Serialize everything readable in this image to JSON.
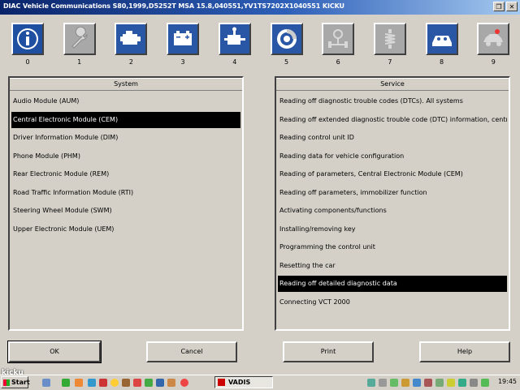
{
  "window": {
    "title": "DIAC  Vehicle Communications  S80,1999,D5252T MSA 15.8,040551,YV1TS7202X1040551 KICKU",
    "restore_label": "❐",
    "close_label": "✕"
  },
  "toolbar": {
    "items": [
      {
        "number": "0",
        "icon": "information-icon",
        "state": "active"
      },
      {
        "number": "1",
        "icon": "wrench-icon",
        "state": "disabled"
      },
      {
        "number": "2",
        "icon": "engine-icon",
        "state": "on"
      },
      {
        "number": "3",
        "icon": "battery-icon",
        "state": "on"
      },
      {
        "number": "4",
        "icon": "gearbox-icon",
        "state": "on"
      },
      {
        "number": "5",
        "icon": "brake-disc-icon",
        "state": "on"
      },
      {
        "number": "6",
        "icon": "steering-axle-icon",
        "state": "disabled"
      },
      {
        "number": "7",
        "icon": "suspension-icon",
        "state": "disabled"
      },
      {
        "number": "8",
        "icon": "body-interior-icon",
        "state": "on"
      },
      {
        "number": "9",
        "icon": "car-body-icon",
        "state": "disabled"
      }
    ]
  },
  "system_panel": {
    "header": "System",
    "items": [
      "Audio Module (AUM)",
      "Central Electronic Module (CEM)",
      "Driver Information Module (DIM)",
      "Phone Module (PHM)",
      "Rear Electronic Module (REM)",
      "Road Traffic Information Module (RTI)",
      "Steering Wheel Module (SWM)",
      "Upper Electronic Module (UEM)"
    ],
    "selected_index": 1
  },
  "service_panel": {
    "header": "Service",
    "items": [
      "Reading off diagnostic trouble codes (DTCs). All systems",
      "Reading off extended diagnostic trouble code (DTC) information, central el",
      "Reading control unit ID",
      "Reading data for vehicle configuration",
      "Reading of parameters, Central Electronic Module (CEM)",
      "Reading off parameters, immobilizer function",
      "Activating components/functions",
      "Installing/removing key",
      "Programming the control unit",
      "Resetting the car",
      "Reading off detailed diagnostic data",
      "Connecting VCT 2000"
    ],
    "selected_index": 10
  },
  "buttons": {
    "ok": "OK",
    "cancel": "Cancel",
    "print": "Print",
    "help": "Help"
  },
  "taskbar": {
    "start_label": "Start",
    "task_label": "VADIS",
    "clock": "19:45"
  },
  "watermark": "kicku",
  "colors": {
    "titlebar": "#0a246a",
    "face": "#d4d0c8",
    "selection": "#000000",
    "active_icon": "#1e4fa0"
  }
}
